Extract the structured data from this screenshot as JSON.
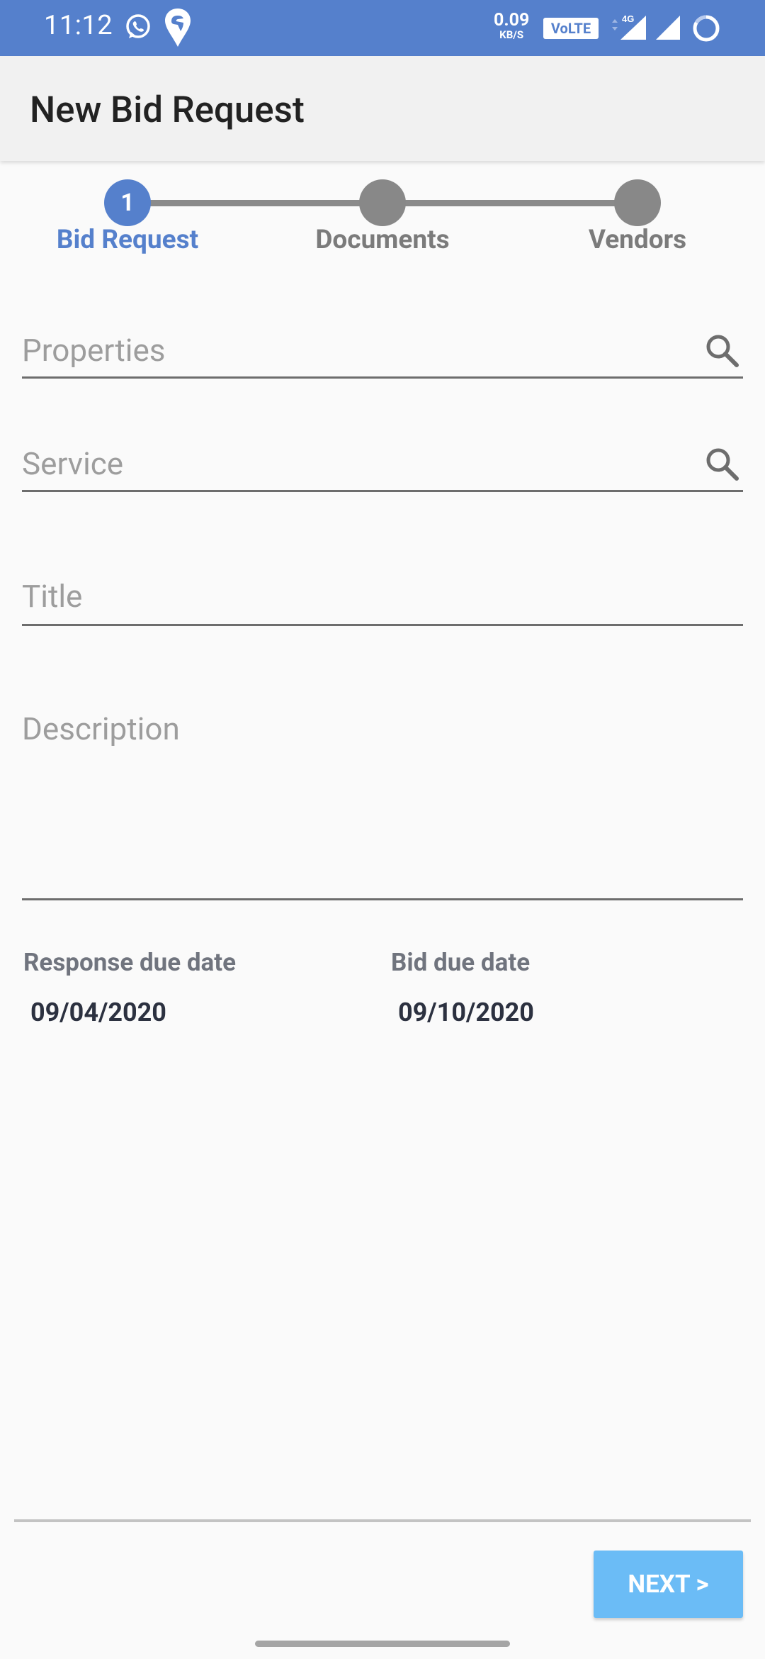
{
  "status_bar": {
    "time": "11:12",
    "net_speed_value": "0.09",
    "net_speed_unit": "KB/S",
    "volte_label": "VoLTE",
    "network_type": "4G"
  },
  "app_bar": {
    "title": "New Bid Request"
  },
  "stepper": {
    "steps": [
      {
        "number": "1",
        "label": "Bid Request",
        "active": true
      },
      {
        "number": "",
        "label": "Documents",
        "active": false
      },
      {
        "number": "",
        "label": "Vendors",
        "active": false
      }
    ]
  },
  "form": {
    "properties_placeholder": "Properties",
    "service_placeholder": "Service",
    "title_placeholder": "Title",
    "description_placeholder": "Description"
  },
  "dates": {
    "response_due_label": "Response due date",
    "response_due_value": "09/04/2020",
    "bid_due_label": "Bid due date",
    "bid_due_value": "09/10/2020"
  },
  "footer": {
    "next_label": "NEXT >"
  },
  "colors": {
    "primary": "#5580cc",
    "next_button": "#6bbcf6",
    "inactive_step": "#888888"
  }
}
